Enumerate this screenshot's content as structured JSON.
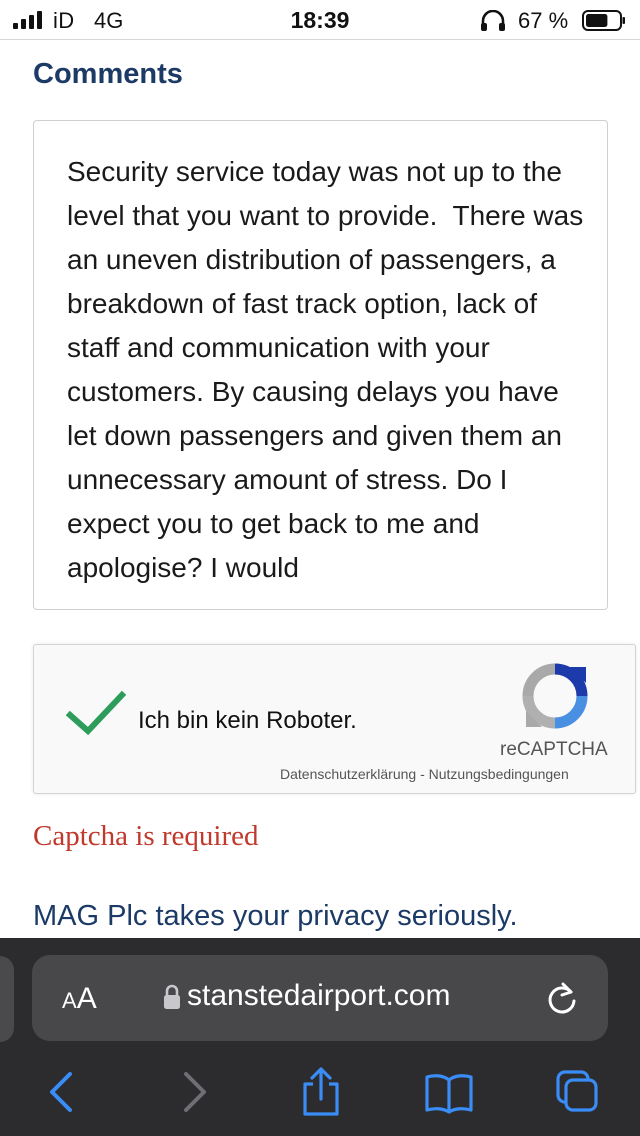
{
  "status_bar": {
    "carrier": "iD",
    "network": "4G",
    "time": "18:39",
    "battery_percent": "67 %",
    "battery_level": 0.67
  },
  "page": {
    "section_title": "Comments",
    "comment_text": "Security service today was not up to the level that you want to provide.  There was an uneven distribution of passengers, a breakdown of fast track option, lack of staff and communication with your customers. By causing delays you have let down passengers and given them an unnecessary amount of stress. Do I expect you to get back to me and apologise? I would",
    "recaptcha": {
      "label": "Ich bin kein Roboter.",
      "brand": "reCAPTCHA",
      "privacy_link": "Datenschutzerklärung",
      "separator": " - ",
      "terms_link": "Nutzungsbedingungen",
      "checked": true
    },
    "error_message": "Captcha is required",
    "privacy_notice": "MAG Plc takes your privacy seriously."
  },
  "browser": {
    "reader_small": "A",
    "reader_big": "A",
    "url": "stanstedairport.com",
    "toolbar": {
      "back_icon": "chevron-left-icon",
      "forward_icon": "chevron-right-icon",
      "share_icon": "share-icon",
      "bookmarks_icon": "book-icon",
      "tabs_icon": "tabs-icon"
    }
  },
  "colors": {
    "heading": "#1c3a66",
    "error": "#c0392b",
    "safari_accent": "#3a8cf7",
    "check": "#2e9d5c"
  }
}
